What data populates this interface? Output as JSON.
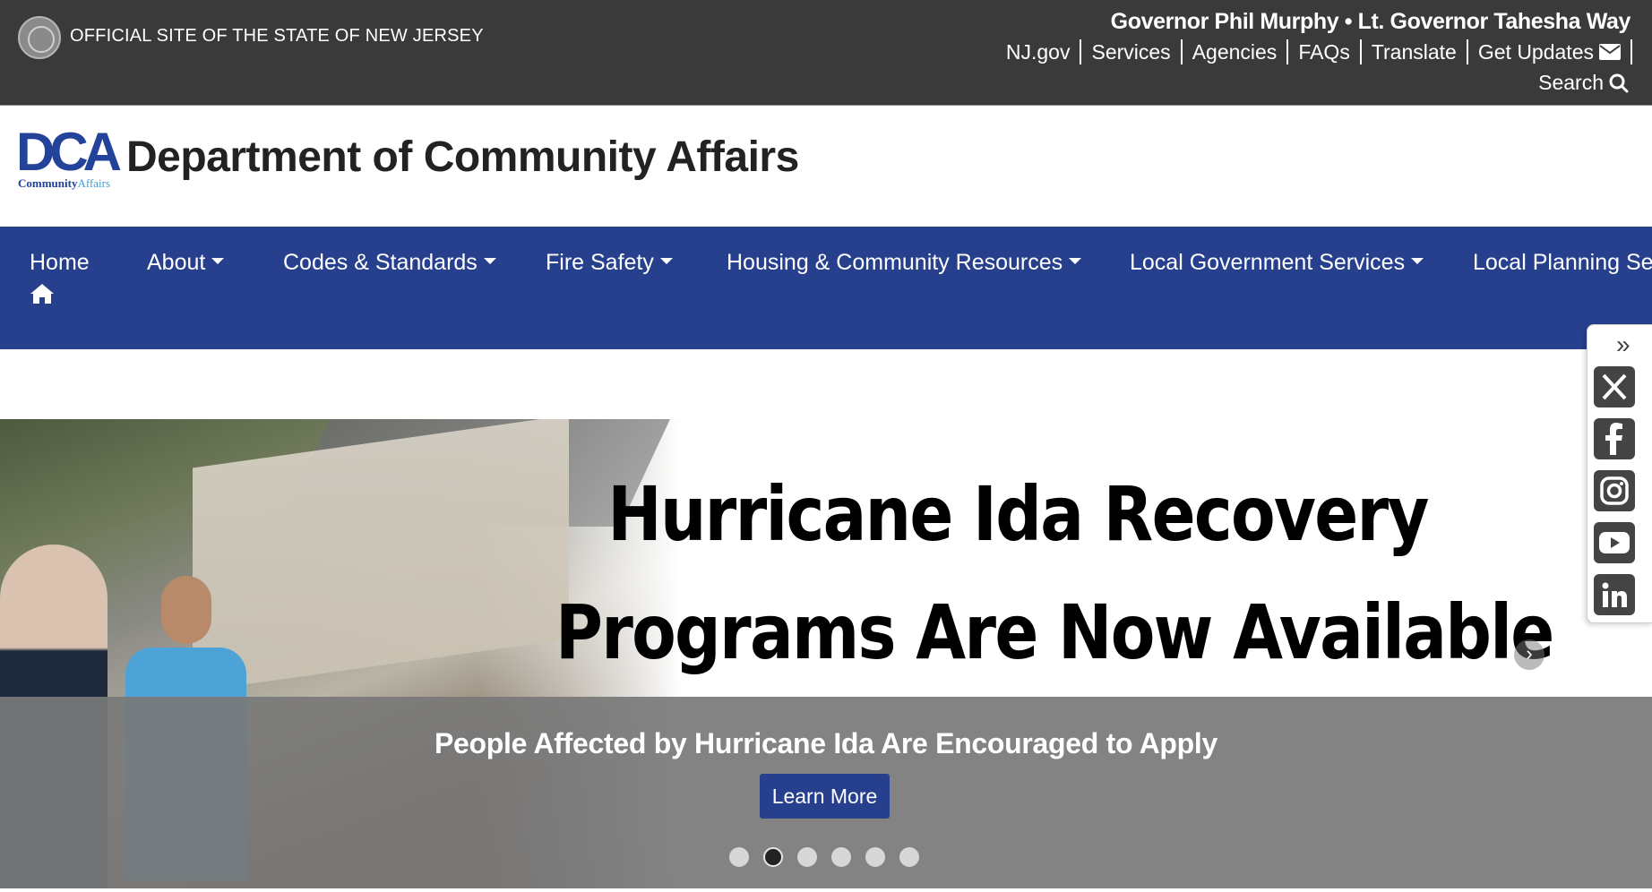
{
  "topbar": {
    "official": "OFFICIAL SITE OF THE STATE OF NEW JERSEY",
    "governor": "Governor Phil Murphy • Lt. Governor Tahesha Way",
    "links": [
      "NJ.gov",
      "Services",
      "Agencies",
      "FAQs",
      "Translate",
      "Get Updates"
    ],
    "search": "Search"
  },
  "header": {
    "logo_text": "DCA",
    "logo_sub_1": "Community",
    "logo_sub_2": "Affairs",
    "title": "Department of Community Affairs"
  },
  "nav": {
    "home": "Home",
    "items": [
      "About",
      "Codes & Standards",
      "Fire Safety",
      "Housing & Community Resources",
      "Local Government Services",
      "Local Planning Ser"
    ]
  },
  "hero": {
    "headline_1": "Hurricane Ida Recovery",
    "headline_2": "Programs Are Now Available",
    "caption": "People Affected by Hurricane Ida Are Encouraged to Apply",
    "button": "Learn More",
    "slide_count": 6,
    "active_slide": 2
  },
  "social": {
    "icons": [
      "x-icon",
      "facebook-icon",
      "instagram-icon",
      "youtube-icon",
      "linkedin-icon"
    ]
  },
  "colors": {
    "topbar": "#3a3a3a",
    "nav": "#27408e",
    "brand": "#23439b"
  }
}
